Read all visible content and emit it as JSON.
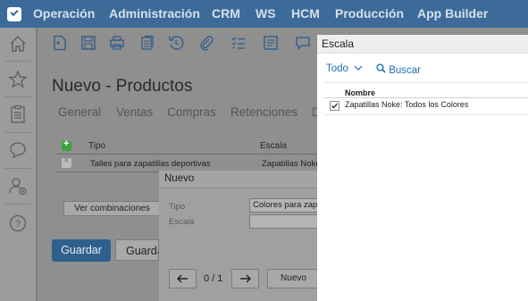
{
  "menu": [
    "Operación",
    "Administración",
    "CRM",
    "WS",
    "HCM",
    "Producción",
    "App Builder"
  ],
  "page_title": "Nuevo - Productos",
  "tabs": [
    "General",
    "Ventas",
    "Compras",
    "Retenciones",
    "D"
  ],
  "grid": {
    "headers": [
      "Tipo",
      "Escala"
    ],
    "rows": [
      {
        "tipo": "Talles para zapatillas deportivas",
        "escala": "Zapatillas Noke"
      }
    ]
  },
  "buttons": {
    "combinations": "Ver combinaciones",
    "save": "Guardar",
    "save2": "Guarda"
  },
  "dialog": {
    "title": "Nuevo",
    "tipo_label": "Tipo",
    "tipo_value": "Colores para zap",
    "escala_label": "Escala",
    "escala_value": "",
    "pager": "0 / 1",
    "nuevo": "Nuevo"
  },
  "popup": {
    "title": "Escala",
    "filter": "Todo",
    "search": "Buscar",
    "column": "Nombre",
    "items": [
      {
        "label": "Zapatillas Noke: Todos los Colores",
        "checked": true
      }
    ]
  },
  "colors": {
    "accent": "#1f6fb5",
    "topbar": "#3c6b9a",
    "primary_button": "#2f5f8c"
  },
  "icons": {
    "sidebar": [
      "home-icon",
      "star-icon",
      "clipboard-icon",
      "chat-icon",
      "user-add-icon",
      "help-icon"
    ],
    "toolbar": [
      "new-doc-icon",
      "save-icon",
      "print-icon",
      "copy-icon",
      "history-icon",
      "attach-icon",
      "checklist-icon",
      "report-icon",
      "comment-icon"
    ]
  }
}
